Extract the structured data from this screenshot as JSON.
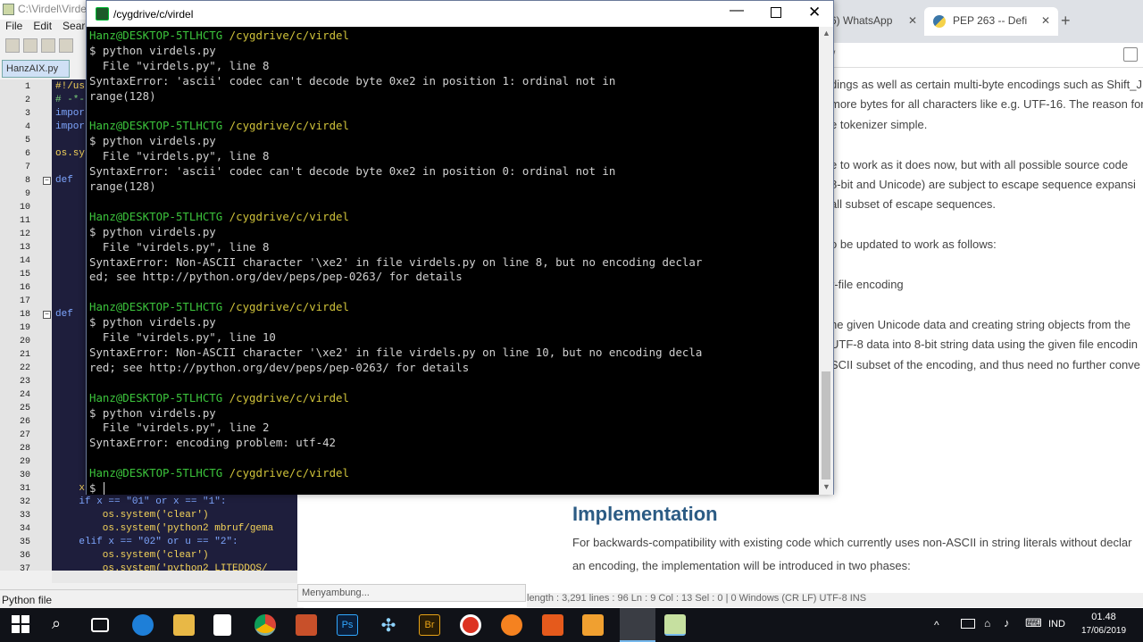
{
  "notepad": {
    "title": "C:\\Virdel\\Virdel",
    "menu": [
      "File",
      "Edit",
      "Search"
    ],
    "tab": "HanzAIX.py",
    "status": "Python file",
    "lines": [
      "1",
      "2",
      "3",
      "4",
      "5",
      "6",
      "7",
      "8",
      "9",
      "10",
      "11",
      "12",
      "13",
      "14",
      "15",
      "16",
      "17",
      "18",
      "19",
      "20",
      "21",
      "22",
      "23",
      "24",
      "25",
      "26",
      "27",
      "28",
      "29",
      "30",
      "31",
      "32",
      "33",
      "34",
      "35",
      "36",
      "37"
    ],
    "code": {
      "l1": "#!/us",
      "l2": "# -*-",
      "l3": "impor",
      "l4": "impor",
      "l6": "os.sy",
      "l8": "def ",
      "l18": "def ",
      "l31": "    x",
      "l32": "    if x == \"01\" or x == \"1\":",
      "l33": "        os.system('clear')",
      "l34": "        os.system('python2 mbruf/gema",
      "l35": "    elif x == \"02\" or u == \"2\":",
      "l36": "        os.system('clear')",
      "l37": "        os.system('python2 LITEDDOS/"
    }
  },
  "terminal": {
    "title": "/cygdrive/c/virdel",
    "lines": [
      {
        "user": "Hanz@DESKTOP-5TLHCTG",
        "path": "/cygdrive/c/virdel"
      },
      {
        "text": "$ python virdels.py"
      },
      {
        "text": "  File \"virdels.py\", line 8"
      },
      {
        "text": "SyntaxError: 'ascii' codec can't decode byte 0xe2 in position 1: ordinal not in"
      },
      {
        "text": "range(128)"
      },
      {
        "text": ""
      },
      {
        "user": "Hanz@DESKTOP-5TLHCTG",
        "path": "/cygdrive/c/virdel"
      },
      {
        "text": "$ python virdels.py"
      },
      {
        "text": "  File \"virdels.py\", line 8"
      },
      {
        "text": "SyntaxError: 'ascii' codec can't decode byte 0xe2 in position 0: ordinal not in"
      },
      {
        "text": "range(128)"
      },
      {
        "text": ""
      },
      {
        "user": "Hanz@DESKTOP-5TLHCTG",
        "path": "/cygdrive/c/virdel"
      },
      {
        "text": "$ python virdels.py"
      },
      {
        "text": "  File \"virdels.py\", line 8"
      },
      {
        "text": "SyntaxError: Non-ASCII character '\\xe2' in file virdels.py on line 8, but no encoding declar"
      },
      {
        "text": "ed; see http://python.org/dev/peps/pep-0263/ for details"
      },
      {
        "text": ""
      },
      {
        "user": "Hanz@DESKTOP-5TLHCTG",
        "path": "/cygdrive/c/virdel"
      },
      {
        "text": "$ python virdels.py"
      },
      {
        "text": "  File \"virdels.py\", line 10"
      },
      {
        "text": "SyntaxError: Non-ASCII character '\\xe2' in file virdels.py on line 10, but no encoding decla"
      },
      {
        "text": "red; see http://python.org/dev/peps/pep-0263/ for details"
      },
      {
        "text": ""
      },
      {
        "user": "Hanz@DESKTOP-5TLHCTG",
        "path": "/cygdrive/c/virdel"
      },
      {
        "text": "$ python virdels.py"
      },
      {
        "text": "  File \"virdels.py\", line 2"
      },
      {
        "text": "SyntaxError: encoding problem: utf-42"
      },
      {
        "text": ""
      },
      {
        "user": "Hanz@DESKTOP-5TLHCTG",
        "path": "/cygdrive/c/virdel"
      },
      {
        "text": "$ "
      }
    ]
  },
  "browser": {
    "tab1": "6) WhatsApp",
    "tab2": "PEP 263 -- Defi",
    "address": "/",
    "article_lines": [
      "dings as well as certain multi-byte encodings such as Shift_J",
      "more bytes for all characters like e.g. UTF-16. The reason for",
      "e tokenizer simple.",
      "",
      "e to work as it does now, but with all possible source code",
      "8-bit and Unicode) are subject to escape sequence expansi",
      "all subset of escape sequences.",
      "",
      "o be updated to work as follows:",
      "",
      "r-file encoding",
      "",
      "he given Unicode data and creating string objects from the",
      "UTF-8 data into 8-bit string data using the given file encodin",
      "SCII subset of the encoding, and thus need no further conve"
    ],
    "heading": "Implementation",
    "para1": "For backwards-compatibility with existing code which currently uses non-ASCII in string literals without declar",
    "para2": "an encoding, the implementation will be introduced in two phases:",
    "loading": "Menyambung...",
    "status_bits": "length : 3,291    lines : 96         Ln : 9    Col : 13    Sel : 0 | 0                    Windows (CR LF)      UTF-8                    INS"
  },
  "taskbar": {
    "lang": "IND",
    "time": "01.48",
    "date": "17/06/2019"
  }
}
